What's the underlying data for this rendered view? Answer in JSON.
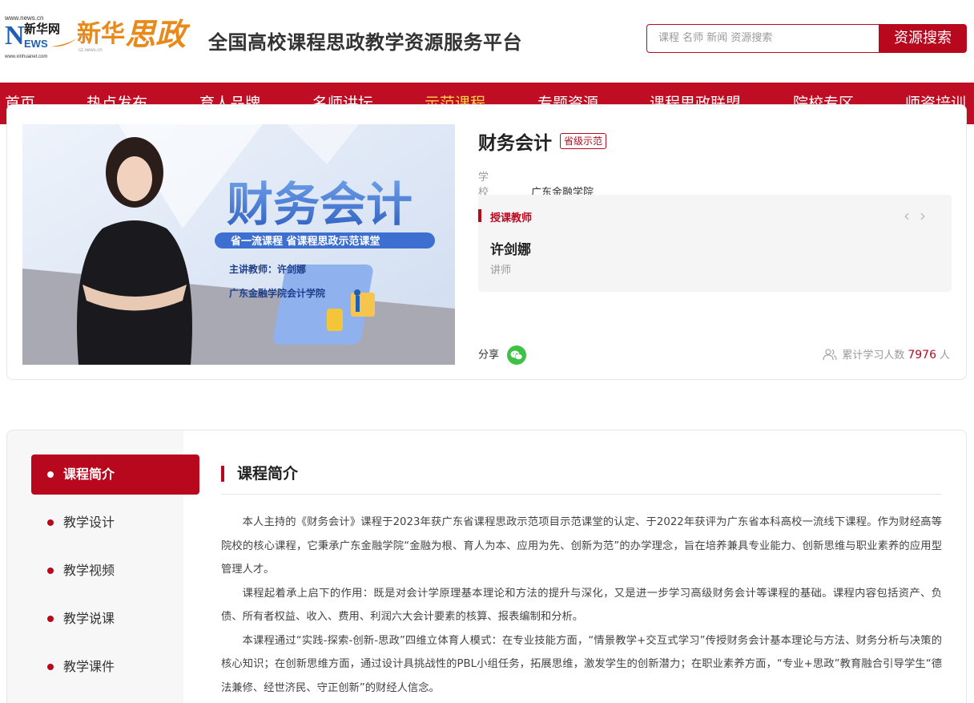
{
  "header": {
    "logo": {
      "news_url": "www.news.cn",
      "news_url_bottom": "www.xinhuanet.com",
      "n_letter": "N",
      "xinhuawang": "新华网",
      "ews": "EWS",
      "xinhua": "新华",
      "sizheng": "思政",
      "sub_url": "sz.news.cn"
    },
    "site_title": "全国高校课程思政教学资源服务平台",
    "search_placeholder": "课程 名师 新闻 资源搜索",
    "search_button": "资源搜索"
  },
  "nav": {
    "items": [
      {
        "label": "首页"
      },
      {
        "label": "热点发布"
      },
      {
        "label": "育人品牌"
      },
      {
        "label": "名师讲坛"
      },
      {
        "label": "示范课程",
        "active": true
      },
      {
        "label": "专题资源"
      },
      {
        "label": "课程思政联盟"
      },
      {
        "label": "院校专区"
      },
      {
        "label": "师资培训"
      }
    ],
    "active_color": "#ffd24a",
    "bg_color": "#bf0d23"
  },
  "course": {
    "cover": {
      "big_title": "财务会计",
      "slogan": "省一流课程  省课程思政示范课堂",
      "teacher_line": "主讲教师：许剑娜",
      "school_line": "广东金融学院会计学院"
    },
    "title": "财务会计",
    "level_badge": "省级示范",
    "school_label": "学校",
    "school_value": "广东金融学院",
    "teacher_heading": "授课教师",
    "teacher_prev": "‹",
    "teacher_next": "›",
    "teacher_name": "许剑娜",
    "teacher_title": "讲师",
    "share_label": "分享",
    "learners_label": "累计学习人数",
    "learners_count": "7976",
    "learners_unit": "人"
  },
  "content": {
    "sidebar": [
      {
        "label": "课程简介",
        "active": true
      },
      {
        "label": "教学设计"
      },
      {
        "label": "教学视频"
      },
      {
        "label": "教学说课"
      },
      {
        "label": "教学课件"
      }
    ],
    "section_title": "课程简介",
    "paragraphs": [
      "本人主持的《财务会计》课程于2023年获广东省课程思政示范项目示范课堂的认定、于2022年获评为广东省本科高校一流线下课程。作为财经高等院校的核心课程，它秉承广东金融学院“金融为根、育人为本、应用为先、创新为范”的办学理念，旨在培养兼具专业能力、创新思维与职业素养的应用型管理人才。",
      "课程起着承上启下的作用：既是对会计学原理基本理论和方法的提升与深化，又是进一步学习高级财务会计等课程的基础。课程内容包括资产、负债、所有者权益、收入、费用、利润六大会计要素的核算、报表编制和分析。",
      "本课程通过“实践-探索-创新-思政”四维立体育人模式：在专业技能方面，“情景教学+交互式学习”传授财务会计基本理论与方法、财务分析与决策的核心知识；在创新思维方面，通过设计具挑战性的PBL小组任务，拓展思维，激发学生的创新潜力；在职业素养方面，“专业+思政”教育融合引导学生“德法兼修、经世济民、守正创新”的财经人信念。"
    ]
  },
  "colors": {
    "brand_red": "#b8081e",
    "logo_orange": "#e8891a",
    "logo_blue": "#1f5fb4",
    "wechat_green": "#3ec144"
  }
}
